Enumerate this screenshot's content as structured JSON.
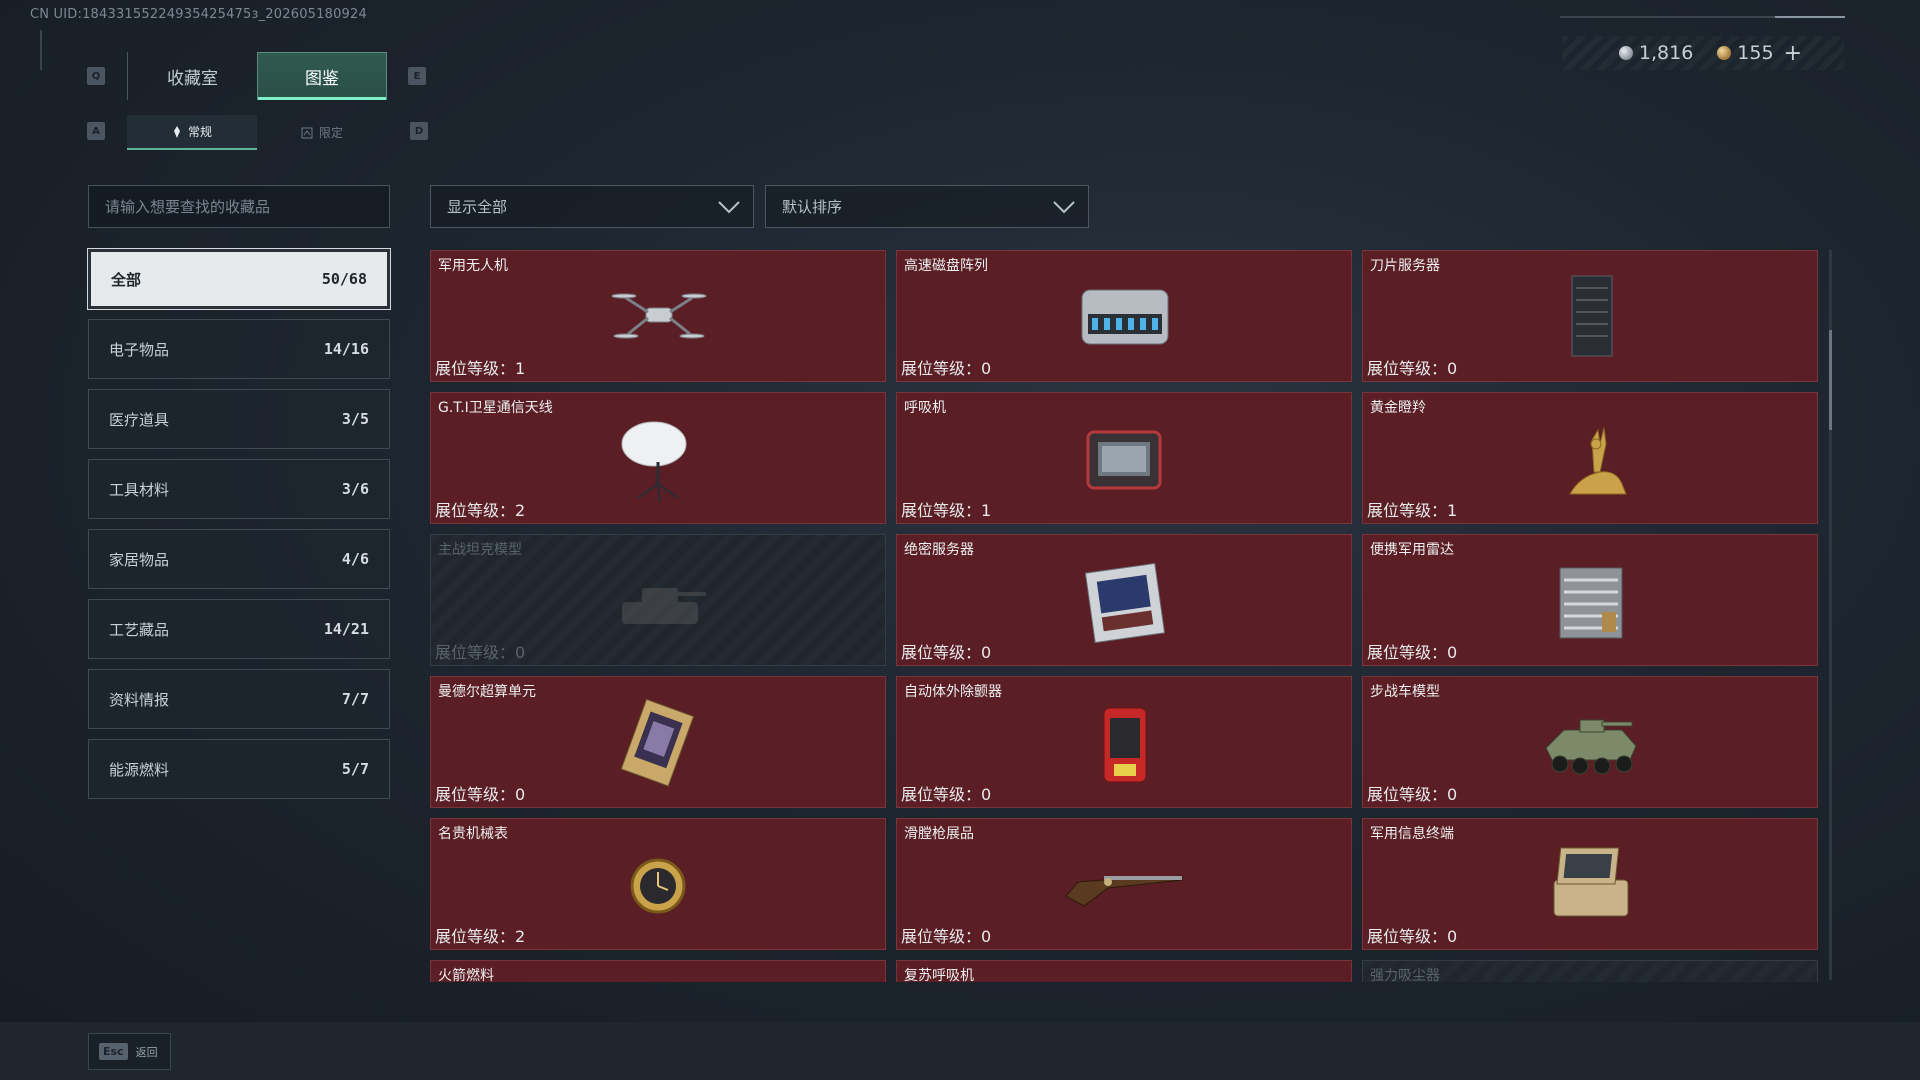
{
  "header": {
    "uid_text": "CN UID:18433155224935425475з_202605180924"
  },
  "currency": {
    "silver": "1,816",
    "gold": "155",
    "plus": "+"
  },
  "main_tabs": [
    {
      "label": "收藏室"
    },
    {
      "label": "图鉴"
    }
  ],
  "main_tab_keys": {
    "left": "Q",
    "right": "E"
  },
  "sub_tabs": [
    {
      "label": "常规"
    },
    {
      "label": "限定"
    }
  ],
  "sub_tab_keys": {
    "left": "A",
    "right": "D"
  },
  "search": {
    "placeholder": "请输入想要查找的收藏品"
  },
  "filter": {
    "label": "显示全部"
  },
  "sort": {
    "label": "默认排序"
  },
  "categories": [
    {
      "label": "全部",
      "count": "50/68"
    },
    {
      "label": "电子物品",
      "count": "14/16"
    },
    {
      "label": "医疗道具",
      "count": "3/5"
    },
    {
      "label": "工具材料",
      "count": "3/6"
    },
    {
      "label": "家居物品",
      "count": "4/6"
    },
    {
      "label": "工艺藏品",
      "count": "14/21"
    },
    {
      "label": "资料情报",
      "count": "7/7"
    },
    {
      "label": "能源燃料",
      "count": "5/7"
    }
  ],
  "level_prefix": "展位等级：",
  "items": [
    {
      "name": "军用无人机",
      "level": "展位等级：1",
      "icon": "drone-icon"
    },
    {
      "name": "高速磁盘阵列",
      "level": "展位等级：0",
      "icon": "disk-array-icon"
    },
    {
      "name": "刀片服务器",
      "level": "展位等级：0",
      "icon": "blade-server-icon"
    },
    {
      "name": "G.T.I卫星通信天线",
      "level": "展位等级：2",
      "icon": "satellite-dish-icon"
    },
    {
      "name": "呼吸机",
      "level": "展位等级：1",
      "icon": "ventilator-icon"
    },
    {
      "name": "黄金瞪羚",
      "level": "展位等级：1",
      "icon": "golden-gazelle-icon"
    },
    {
      "name": "主战坦克模型",
      "level": "展位等级：0",
      "icon": "tank-model-icon",
      "locked": true
    },
    {
      "name": "绝密服务器",
      "level": "展位等级：0",
      "icon": "secret-server-icon"
    },
    {
      "name": "便携军用雷达",
      "level": "展位等级：0",
      "icon": "radar-icon"
    },
    {
      "name": "曼德尔超算单元",
      "level": "展位等级：0",
      "icon": "supercomputer-unit-icon"
    },
    {
      "name": "自动体外除颤器",
      "level": "展位等级：0",
      "icon": "defibrillator-icon"
    },
    {
      "name": "步战车模型",
      "level": "展位等级：0",
      "icon": "ifv-model-icon"
    },
    {
      "name": "名贵机械表",
      "level": "展位等级：2",
      "icon": "watch-icon"
    },
    {
      "name": "滑膛枪展品",
      "level": "展位等级：0",
      "icon": "musket-icon"
    },
    {
      "name": "军用信息终端",
      "level": "展位等级：0",
      "icon": "terminal-icon"
    },
    {
      "name": "火箭燃料",
      "level": "",
      "icon": "rocket-fuel-icon"
    },
    {
      "name": "复苏呼吸机",
      "level": "",
      "icon": "resuscitator-icon"
    },
    {
      "name": "强力吸尘器",
      "level": "",
      "icon": "vacuum-icon",
      "locked": true
    }
  ],
  "footer": {
    "esc_key": "Esc",
    "back_label": "返回"
  },
  "colors": {
    "card_bg": "#5a1e24",
    "accent": "#7ef0c5",
    "active_tab": "#2f5a50"
  }
}
